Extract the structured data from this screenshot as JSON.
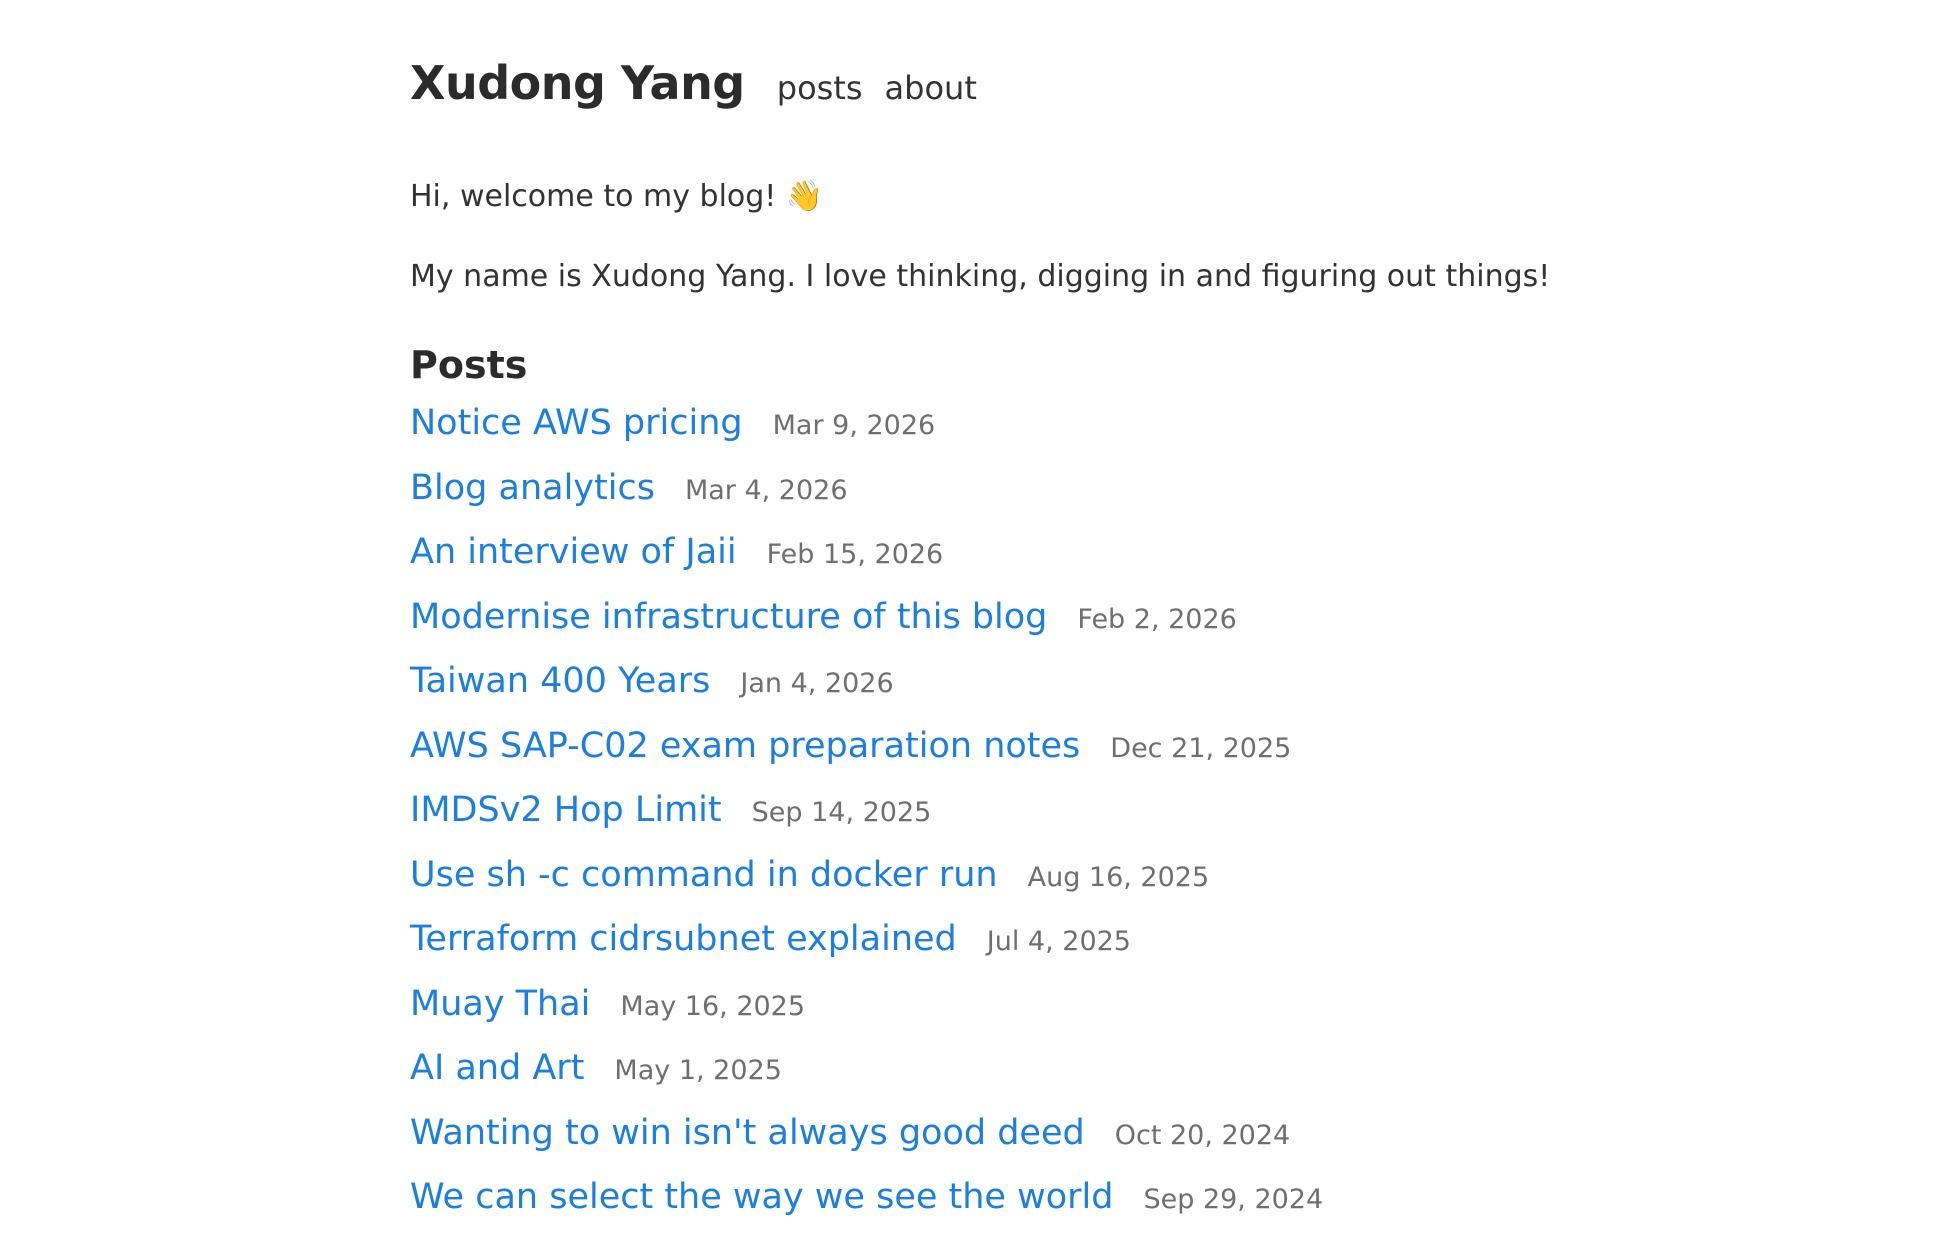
{
  "header": {
    "site_title": "Xudong Yang",
    "nav": [
      {
        "label": "posts"
      },
      {
        "label": "about"
      }
    ]
  },
  "intro": {
    "greeting": "Hi, welcome to my blog! 👋",
    "bio": "My name is Xudong Yang. I love thinking, digging in and figuring out things!"
  },
  "posts_section": {
    "heading": "Posts",
    "items": [
      {
        "title": "Notice AWS pricing",
        "date": "Mar 9, 2026"
      },
      {
        "title": "Blog analytics",
        "date": "Mar 4, 2026"
      },
      {
        "title": "An interview of Jaii",
        "date": "Feb 15, 2026"
      },
      {
        "title": "Modernise infrastructure of this blog",
        "date": "Feb 2, 2026"
      },
      {
        "title": "Taiwan 400 Years",
        "date": "Jan 4, 2026"
      },
      {
        "title": "AWS SAP-C02 exam preparation notes",
        "date": "Dec 21, 2025"
      },
      {
        "title": "IMDSv2 Hop Limit",
        "date": "Sep 14, 2025"
      },
      {
        "title": "Use sh -c command in docker run",
        "date": "Aug 16, 2025"
      },
      {
        "title": "Terraform cidrsubnet explained",
        "date": "Jul 4, 2025"
      },
      {
        "title": "Muay Thai",
        "date": "May 16, 2025"
      },
      {
        "title": "AI and Art",
        "date": "May 1, 2025"
      },
      {
        "title": "Wanting to win isn't always good deed",
        "date": "Oct 20, 2024"
      },
      {
        "title": "We can select the way we see the world",
        "date": "Sep 29, 2024"
      }
    ]
  },
  "colors": {
    "link": "#1a7fe0",
    "date": "#6f6f6f",
    "text": "#333333",
    "background": "#ffffff"
  }
}
